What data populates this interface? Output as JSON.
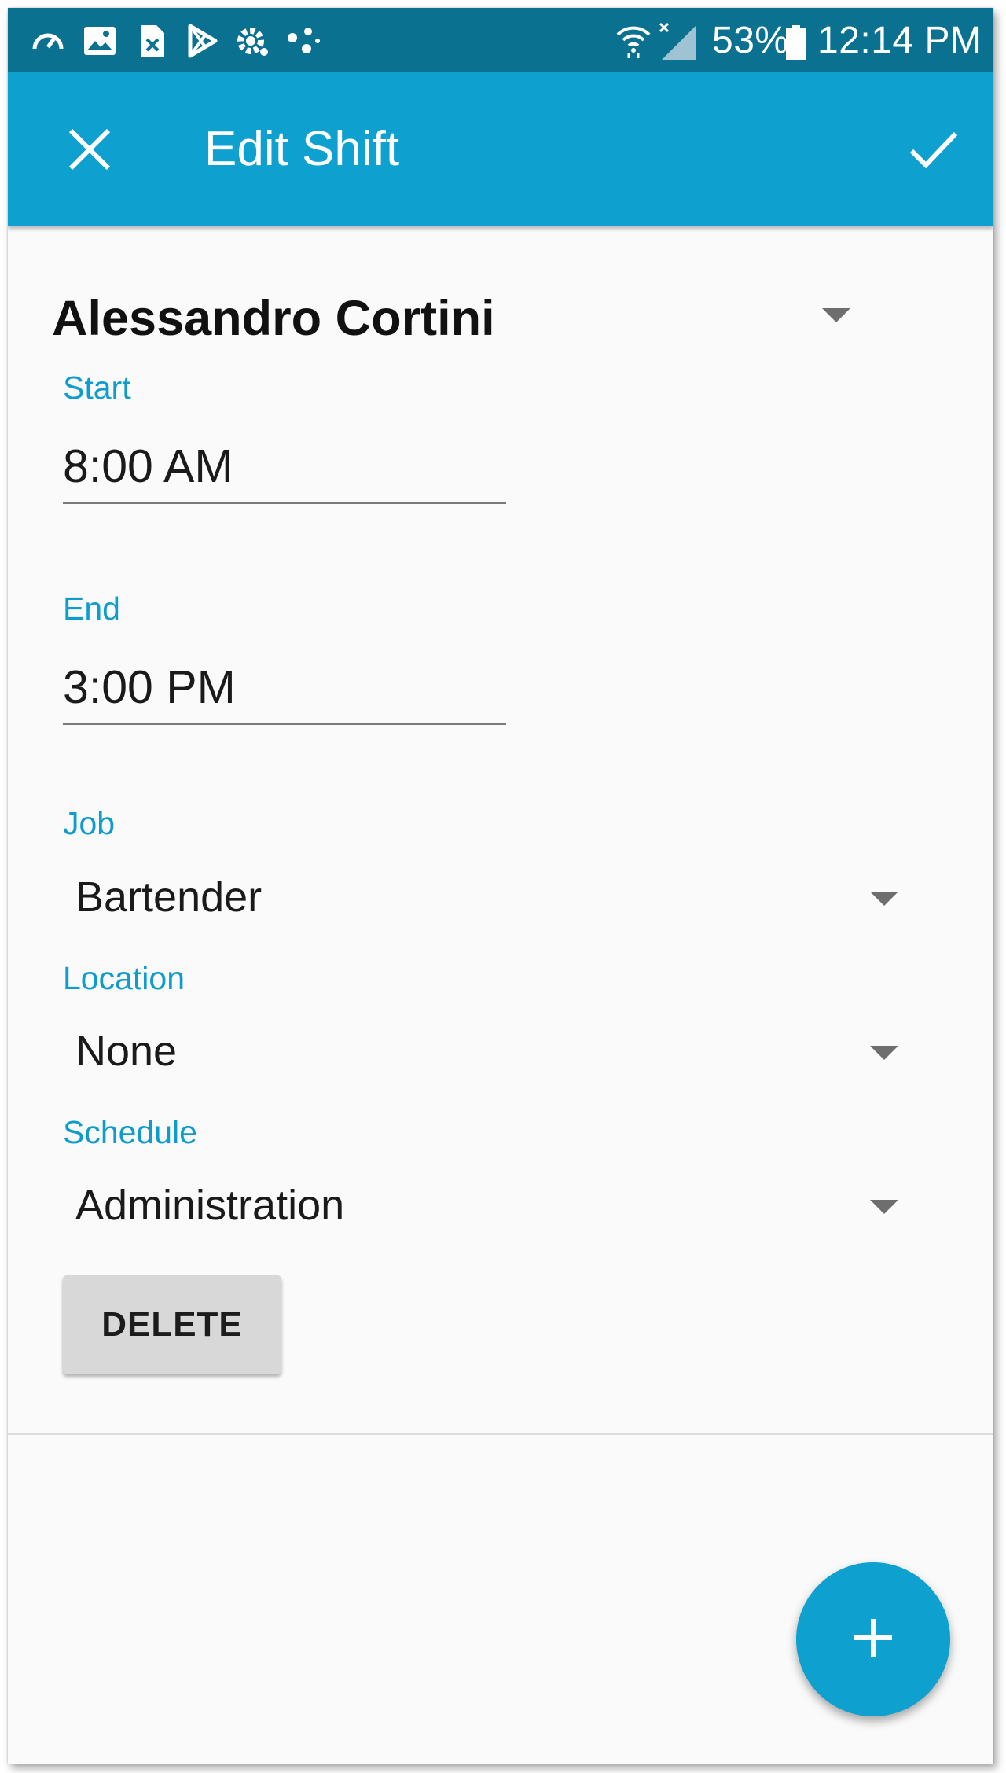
{
  "status_bar": {
    "notification_icons": [
      "speedometer-icon",
      "image-icon",
      "file-x-icon",
      "play-store-icon",
      "settings-gear-icon",
      "dots-icon"
    ],
    "battery_percent": "53%",
    "time": "12:14 PM",
    "bg_color": "#0b7191"
  },
  "app_bar": {
    "title": "Edit Shift",
    "close_icon": "close-icon",
    "confirm_icon": "check-icon",
    "bg_color": "#0ea1d0"
  },
  "form": {
    "employee_name": "Alessandro Cortini",
    "start_label": "Start",
    "start_value": "8:00 AM",
    "end_label": "End",
    "end_value": "3:00 PM",
    "job_label": "Job",
    "job_value": "Bartender",
    "location_label": "Location",
    "location_value": "None",
    "schedule_label": "Schedule",
    "schedule_value": "Administration",
    "delete_label": "DELETE",
    "accent_color": "#0e9ccc"
  },
  "fab": {
    "icon": "plus-icon"
  }
}
